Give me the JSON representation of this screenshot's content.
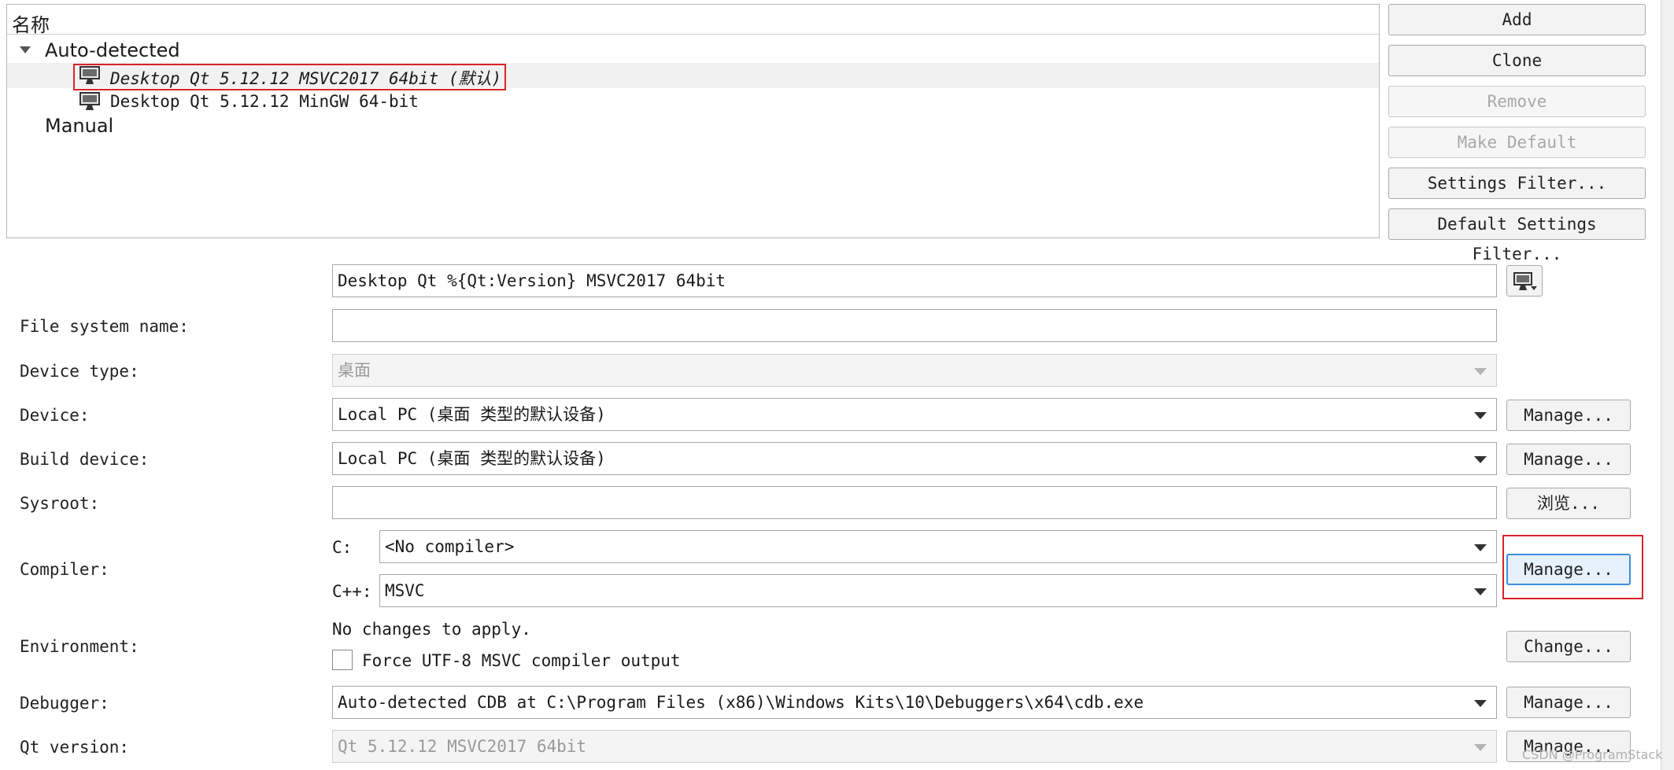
{
  "tree": {
    "header": "名称",
    "groups": [
      {
        "label": "Auto-detected",
        "expanded": true
      },
      {
        "label": "Manual"
      }
    ],
    "kits": [
      {
        "name": "Desktop Qt 5.12.12 MSVC2017 64bit (默认)",
        "selected": true
      },
      {
        "name": "Desktop Qt 5.12.12 MinGW 64-bit"
      }
    ]
  },
  "side_buttons": {
    "add": "Add",
    "clone": "Clone",
    "remove": "Remove",
    "make_default": "Make Default",
    "settings_filter": "Settings Filter...",
    "default_settings_filter": "Default Settings Filter..."
  },
  "form": {
    "name_value": "Desktop Qt %{Qt:Version} MSVC2017 64bit",
    "file_system_name": {
      "label": "File system name:",
      "value": ""
    },
    "device_type": {
      "label": "Device type:",
      "value": "桌面"
    },
    "device": {
      "label": "Device:",
      "value": "Local PC (桌面 类型的默认设备)",
      "button": "Manage..."
    },
    "build_device": {
      "label": "Build device:",
      "value": "Local PC (桌面 类型的默认设备)",
      "button": "Manage..."
    },
    "sysroot": {
      "label": "Sysroot:",
      "value": "",
      "button": "浏览..."
    },
    "compiler": {
      "label": "Compiler:",
      "c_label": "C:",
      "c_value": "<No compiler>",
      "cpp_label": "C++:",
      "cpp_value": "MSVC",
      "button": "Manage..."
    },
    "environment": {
      "label": "Environment:",
      "status": "No changes to apply.",
      "checkbox_label": "Force UTF-8 MSVC compiler output",
      "checkbox_checked": false,
      "button": "Change..."
    },
    "debugger": {
      "label": "Debugger:",
      "value": "Auto-detected CDB at C:\\Program Files (x86)\\Windows Kits\\10\\Debuggers\\x64\\cdb.exe",
      "button": "Manage..."
    },
    "qt_version": {
      "label": "Qt version:",
      "value": "Qt 5.12.12 MSVC2017 64bit",
      "button": "Manage..."
    }
  },
  "watermark": "CSDN @ProgramStack",
  "colors": {
    "highlight": "#d9232a",
    "focus": "#3d8fd9"
  }
}
